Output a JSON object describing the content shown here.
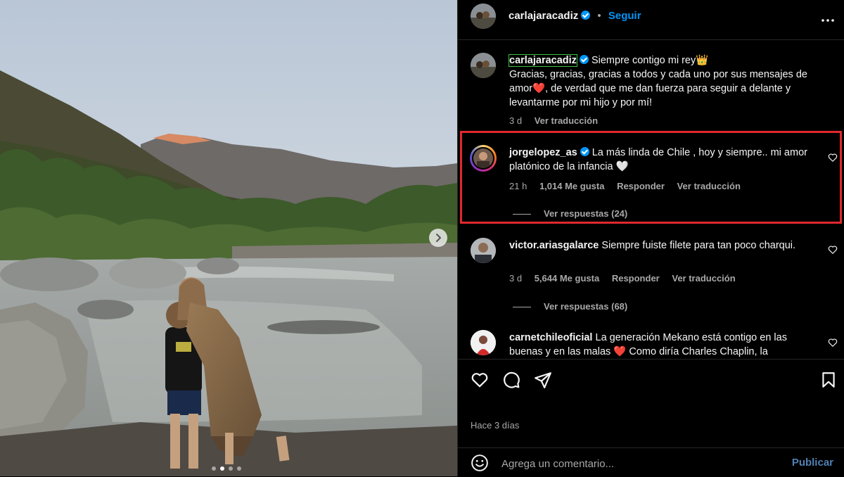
{
  "header": {
    "username": "carlajaracadiz",
    "separator": "•",
    "follow_label": "Seguir",
    "more_icon": "more-horizontal-icon"
  },
  "caption": {
    "username": "carlajaracadiz",
    "text_line1": "Siempre contigo mi rey👑",
    "text_rest": "Gracias, gracias, gracias a todos y cada uno por sus mensajes de amor❤️, de verdad que me dan fuerza para seguir a delante y levantarme por mi hijo y por mí!",
    "time": "3 d",
    "translate": "Ver traducción"
  },
  "comments": [
    {
      "username": "jorgelopez_as",
      "text": "La más linda de Chile , hoy y siempre.. mi amor platónico de la infancia 🤍",
      "time": "21 h",
      "likes": "1,014 Me gusta",
      "reply": "Responder",
      "translate": "Ver traducción",
      "replies": "Ver respuestas (24)"
    },
    {
      "username": "victor.ariasgalarce",
      "text": "Siempre fuiste filete para tan poco charqui.",
      "time": "3 d",
      "likes": "5,644 Me gusta",
      "reply": "Responder",
      "translate": "Ver traducción",
      "replies": "Ver respuestas (68)"
    },
    {
      "username": "carnetchileoficial",
      "text": "La generación Mekano está contigo en las buenas y en las malas ❤️ Como diría Charles Chaplin, la"
    }
  ],
  "post": {
    "time_ago": "Hace 3 días"
  },
  "comment_box": {
    "placeholder": "Agrega un comentario...",
    "publish_label": "Publicar"
  },
  "carousel": {
    "total_slides": 4,
    "active_slide": 2
  }
}
